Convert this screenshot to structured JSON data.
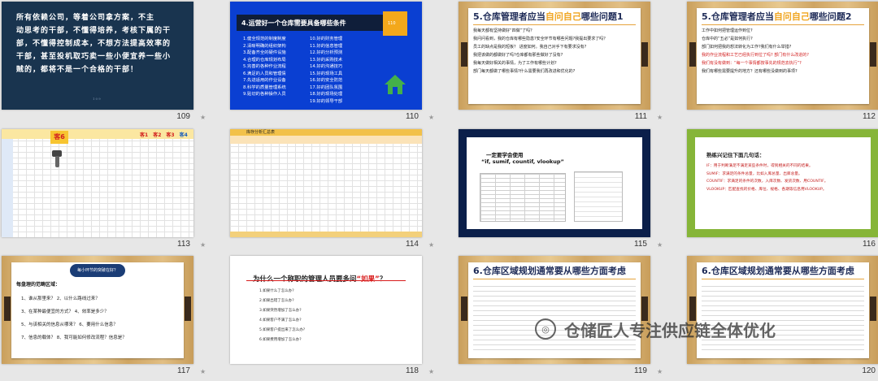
{
  "slides": [
    {
      "num": "109",
      "lines": [
        "所有依赖公司，等着公司拿方案，不主",
        "动思考的干部，不懂得培养，考核下属的干",
        "部，不懂得控制成本，不想方法提高效率的",
        "干部，甚至投机取巧卖一些小便宜养一些小",
        "贼的，都将不是一个合格的干部！"
      ],
      "page": "109"
    },
    {
      "num": "110",
      "title": "4.运营好一个仓库需要具备哪些条件",
      "badge": "110",
      "col1": [
        "1.健全规范的制度制度",
        "2.清晰明确的组织架构",
        "3.配备齐全的硬件设施",
        "4.合理的仓库规划布局",
        "5.完善的各种作业流程",
        "6.满足的人员和管理情",
        "7.先进适用的作业设备",
        "8.科学的质量管理系统",
        "9.贴切的各种操作人员"
      ],
      "col2": [
        "10.好的财务管理",
        "11.好的信息管理",
        "12.好的分析预测",
        "13.好的采购技术",
        "14.好的沟通技巧",
        "15.好的现场工具",
        "16.好的安全防范",
        "17.好的团队氛围",
        "18.好的现场处理",
        "19.好的领导干部"
      ]
    },
    {
      "num": "111",
      "title_a": "5.仓库管理者应当",
      "title_b": "自问自己",
      "title_c": "哪些问题1",
      "items": [
        "我每天都有坚持做好“四做”了吗？",
        "我问问看到，我的仓库有哪些隐患?安全环节有哪些问题?我提出要求了吗？",
        "员工的缺点是我的短板？ 进度如何。我自己对手下有要求没有?",
        "我把该做的都做好了吗?仓库都有那些做好了没有?",
        "我每天做好相关的事情，为了工作有哪些计划?",
        "部门每天都做了哪些事情?什么需要我们再改进和优化的?"
      ]
    },
    {
      "num": "112",
      "title_a": "5.仓库管理者应当",
      "title_b": "自问自己",
      "title_c": "哪些问题2",
      "items": [
        "工作中如何把管理运作到位?",
        "仓库中的“五必”是如何执行?",
        "部门如何把我的想法转化为工作?我们有什么举措?",
        "我的作业流程和工艺已经执行到位了吗?  部门有什么改进的?",
        "我们有没有做到：“每一个事情都按事先的规范去执行”?",
        "我们有哪些需要提升的地方？还有哪些没做到的事项?"
      ]
    },
    {
      "num": "113",
      "tag": "客6",
      "tabs": [
        "客1",
        "客2",
        "客3",
        "客4"
      ]
    },
    {
      "num": "114",
      "head": "库存分析汇总表"
    },
    {
      "num": "115",
      "line1": "一定要学会使用",
      "line2": "“if, sumif, countif, vlookup”"
    },
    {
      "num": "116",
      "sub": "熟练兴记住下面几句话：",
      "rules": [
        "IF：用于判断满足不满足某些条件时，得到相关的不同的结果。",
        "SUMIF：求满足的条件总量，比如入库总量、出库总量。",
        "COUNTIF：求满足的条件的次数，入库次数、发货次数、用COUNTIF。",
        "VLOOKUP：匹配查找的价格、库位、规格、各期等信息用VLOOKUP。"
      ]
    },
    {
      "num": "117",
      "cloud": "每小环节的突破在好？",
      "lead": "每盘理的范畴区域：",
      "qs": [
        "1、谁从那里来？  2、以什么路线过来？",
        "3、在某种最便宜的方式？  4、效率是多少？",
        "5、与该相关的信息从哪来？  6、要用什么信息？",
        "7、信息的载体？  8、我可能如何修改流程？信息是？"
      ]
    },
    {
      "num": "118",
      "title": "为什么一个称职的管理人员要多问",
      "quote": "“如果”",
      "tail": "？",
      "rs": [
        "1.如果什么了怎么办?",
        "2.如果出错了怎么办?",
        "3.如果突然增加了怎么办?",
        "4.如果客户不满了怎么办?",
        "5.如果客户提出来了怎么办?",
        "6.如果费用增加了怎么办?"
      ]
    },
    {
      "num": "119",
      "title": "6.仓库区域规划通常要从哪些方面考虑"
    },
    {
      "num": "120",
      "title": "6.仓库区域规划通常要从哪些方面考虑"
    }
  ],
  "watermark": "仓储匠人专注供应链全体优化"
}
